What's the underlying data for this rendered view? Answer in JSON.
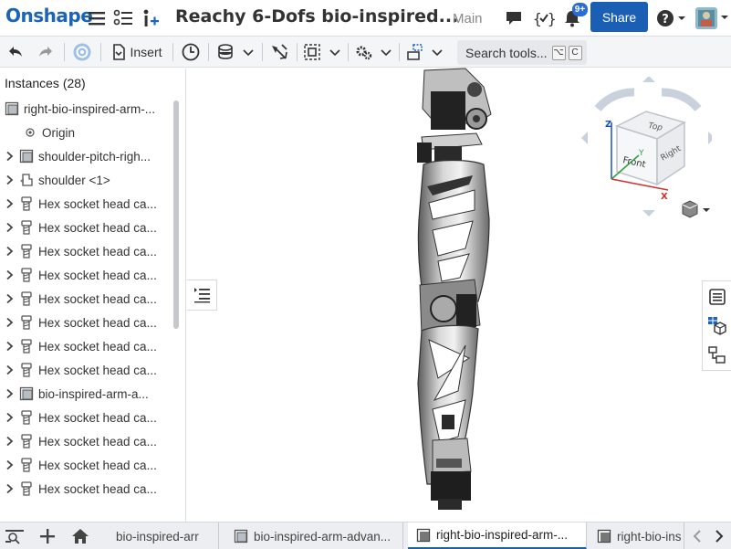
{
  "header": {
    "logo": "Onshape",
    "doc_title": "Reachy 6-Dofs bio-inspired...",
    "branch": "Main",
    "share_label": "Share",
    "notification_count": "9+",
    "icons": [
      "hamburger-menu-icon",
      "feature-list-icon",
      "insert-icon",
      "comment-icon",
      "variables-icon",
      "bell-icon",
      "help-icon",
      "avatar"
    ]
  },
  "toolbar": {
    "insert_label": "Insert",
    "search_label": "Search tools...",
    "search_keys": [
      "⌥",
      "C"
    ]
  },
  "panel": {
    "title": "Instances (28)",
    "items": [
      {
        "label": "right-bio-inspired-arm-...",
        "icon": "part-studio-icon",
        "expandable": false,
        "indent": 0
      },
      {
        "label": "Origin",
        "icon": "origin-icon",
        "expandable": false,
        "indent": 1
      },
      {
        "label": "shoulder-pitch-righ...",
        "icon": "part-studio-icon",
        "expandable": true,
        "indent": 1
      },
      {
        "label": "shoulder <1>",
        "icon": "part-icon",
        "expandable": true,
        "indent": 1
      },
      {
        "label": "Hex socket head ca...",
        "icon": "screw-icon",
        "expandable": true,
        "indent": 1
      },
      {
        "label": "Hex socket head ca...",
        "icon": "screw-icon",
        "expandable": true,
        "indent": 1
      },
      {
        "label": "Hex socket head ca...",
        "icon": "screw-icon",
        "expandable": true,
        "indent": 1
      },
      {
        "label": "Hex socket head ca...",
        "icon": "screw-icon",
        "expandable": true,
        "indent": 1
      },
      {
        "label": "Hex socket head ca...",
        "icon": "screw-icon",
        "expandable": true,
        "indent": 1
      },
      {
        "label": "Hex socket head ca...",
        "icon": "screw-icon",
        "expandable": true,
        "indent": 1
      },
      {
        "label": "Hex socket head ca...",
        "icon": "screw-icon",
        "expandable": true,
        "indent": 1
      },
      {
        "label": "Hex socket head ca...",
        "icon": "screw-icon",
        "expandable": true,
        "indent": 1
      },
      {
        "label": "bio-inspired-arm-a...",
        "icon": "part-studio-icon",
        "expandable": true,
        "indent": 1
      },
      {
        "label": "Hex socket head ca...",
        "icon": "screw-icon",
        "expandable": true,
        "indent": 1
      },
      {
        "label": "Hex socket head ca...",
        "icon": "screw-icon",
        "expandable": true,
        "indent": 1
      },
      {
        "label": "Hex socket head ca...",
        "icon": "screw-icon",
        "expandable": true,
        "indent": 1
      },
      {
        "label": "Hex socket head ca...",
        "icon": "screw-icon",
        "expandable": true,
        "indent": 1
      }
    ]
  },
  "view_cube": {
    "top": "Top",
    "front": "Front",
    "right": "Right",
    "axis_x": "X",
    "axis_y": "Y",
    "axis_z": "Z"
  },
  "bottom_tabs": [
    {
      "label": "bio-inspired-arr",
      "icon": "",
      "active": false
    },
    {
      "label": "bio-inspired-arm-advan...",
      "icon": "part-studio-icon",
      "active": false
    },
    {
      "label": "right-bio-inspired-arm-...",
      "icon": "assembly-icon",
      "active": true
    },
    {
      "label": "right-bio-ins",
      "icon": "assembly-icon",
      "active": false
    }
  ],
  "colors": {
    "brand": "#1c64b7",
    "share": "#1a5fb4",
    "axis_x": "#d32f2f",
    "axis_y": "#2e9e3e",
    "axis_z": "#1a4fc0"
  }
}
